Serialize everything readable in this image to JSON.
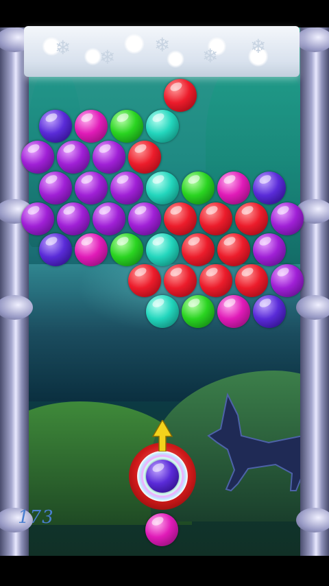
{
  "game": {
    "score": "173",
    "colors": {
      "red": "#ec1c2b",
      "purple": "#a020d6",
      "violet": "#5a2bd8",
      "magenta": "#e01bb8",
      "green": "#2ad421",
      "teal": "#23d6bd"
    },
    "grid": {
      "rows": [
        {
          "offset": true,
          "cells": [
            null,
            null,
            null,
            null,
            "red",
            null,
            null,
            null
          ]
        },
        {
          "offset": false,
          "cells": [
            null,
            "violet",
            "magenta",
            "green",
            "teal",
            null,
            null,
            null,
            null
          ]
        },
        {
          "offset": true,
          "cells": [
            "purple",
            "purple",
            "purple",
            "red",
            null,
            null,
            null,
            null
          ]
        },
        {
          "offset": false,
          "cells": [
            null,
            "purple",
            "purple",
            "purple",
            "teal",
            "green",
            "magenta",
            "violet",
            null
          ]
        },
        {
          "offset": true,
          "cells": [
            "purple",
            "purple",
            "purple",
            "purple",
            "red",
            "red",
            "red",
            "purple"
          ]
        },
        {
          "offset": false,
          "cells": [
            null,
            "violet",
            "magenta",
            "green",
            "teal",
            "red",
            "red",
            "purple",
            null
          ]
        },
        {
          "offset": true,
          "cells": [
            null,
            null,
            null,
            "red",
            "red",
            "red",
            "red",
            "purple"
          ]
        },
        {
          "offset": false,
          "cells": [
            null,
            null,
            null,
            null,
            "teal",
            "green",
            "magenta",
            "violet",
            null
          ]
        }
      ]
    },
    "shooter": {
      "loaded": "violet",
      "next": "magenta"
    }
  }
}
